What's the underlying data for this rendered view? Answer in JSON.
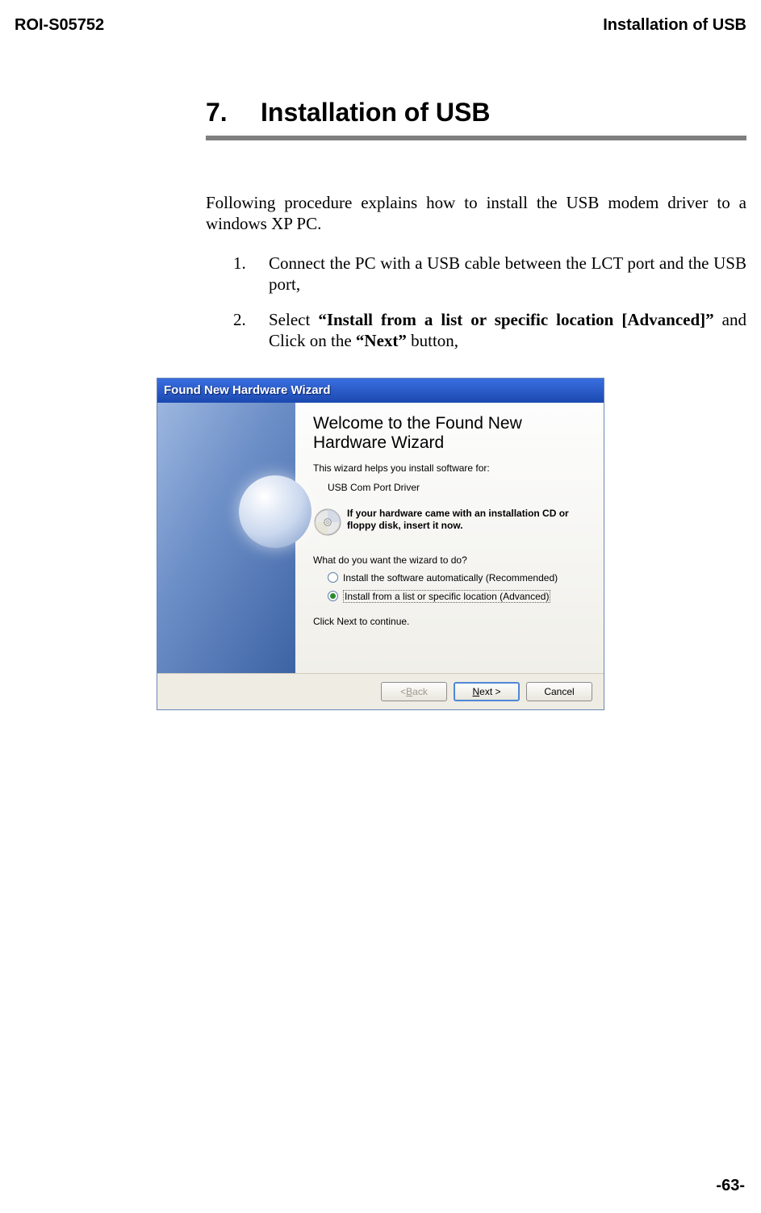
{
  "header": {
    "left": "ROI-S05752",
    "right": "Installation of USB"
  },
  "section": {
    "number": "7.",
    "title": "Installation of USB"
  },
  "intro": "Following procedure explains how to install the USB modem driver to a windows XP PC.",
  "steps": [
    {
      "num": "1.",
      "text": "Connect the PC with a USB cable between the LCT port and the USB port,"
    },
    {
      "num": "2.",
      "pre": "Select ",
      "quoted1": "“Install from a list or specific location [Advanced]”",
      "mid": " and Click on the ",
      "quoted2": "“Next”",
      "post": " button,"
    }
  ],
  "wizard": {
    "titlebar": "Found New Hardware Wizard",
    "heading": "Welcome to the Found New Hardware Wizard",
    "help_line": "This wizard helps you install software for:",
    "device": "USB Com Port Driver",
    "cd_notice": "If your hardware came with an installation CD or floppy disk, insert it now.",
    "question": "What do you want the wizard to do?",
    "radio1": "Install the software automatically (Recommended)",
    "radio2": "Install from a list or specific location (Advanced)",
    "continue": "Click Next to continue.",
    "btn_back_pre": "< ",
    "btn_back_u": "B",
    "btn_back_post": "ack",
    "btn_next_u": "N",
    "btn_next_post": "ext >",
    "btn_cancel": "Cancel"
  },
  "page_num": "-63-"
}
